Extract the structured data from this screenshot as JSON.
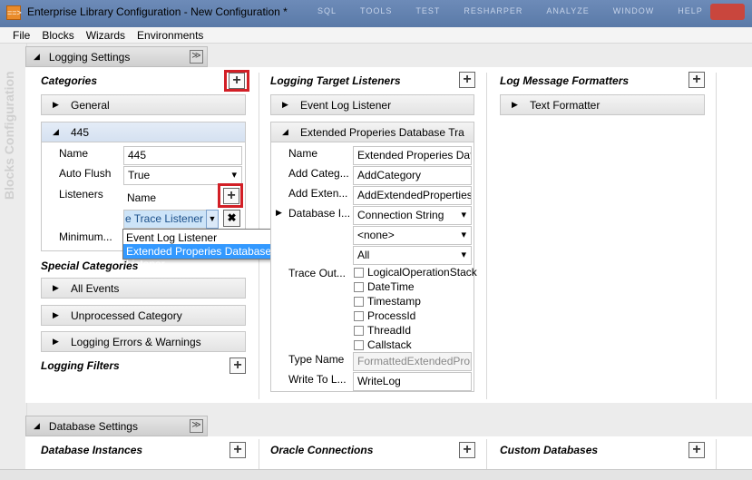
{
  "window": {
    "title": "Enterprise Library Configuration - New Configuration *",
    "icon_text": "==>",
    "vs_menu": [
      "SQL",
      "TOOLS",
      "TEST",
      "RESHARPER",
      "ANALYZE",
      "WINDOW",
      "HELP"
    ]
  },
  "menu": [
    "File",
    "Blocks",
    "Wizards",
    "Environments"
  ],
  "sidebar_label": "Blocks Configuration",
  "logging": {
    "header": "Logging Settings",
    "categories": {
      "title": "Categories",
      "general": "General",
      "expanded": {
        "title": "445",
        "name_label": "Name",
        "name_value": "445",
        "autoflush_label": "Auto Flush",
        "autoflush_value": "True",
        "listeners_label": "Listeners",
        "listeners_col": "Name",
        "listener_value": "e Trace Listener",
        "minimum_label": "Minimum...",
        "dropdown_options": [
          "Event Log Listener",
          "Extended Properies Database Trace Listener"
        ]
      }
    },
    "special": {
      "title": "Special Categories",
      "items": [
        "All Events",
        "Unprocessed Category",
        "Logging Errors & Warnings"
      ]
    },
    "filters": {
      "title": "Logging Filters"
    },
    "targets": {
      "title": "Logging Target Listeners",
      "event_log": "Event Log Listener",
      "expanded": {
        "title": "Extended Properies Database Tra",
        "name_label": "Name",
        "name_value": "Extended Properies Dat",
        "addcat_label": "Add Categ...",
        "addcat_value": "AddCategory",
        "addext_label": "Add Exten...",
        "addext_value": "AddExtendedProperties",
        "dbi_label": "Database I...",
        "dbi_value": "Connection String",
        "filter_value": "<none>",
        "sev_value": "All",
        "trace_label": "Trace Out...",
        "trace_options": [
          "LogicalOperationStack",
          "DateTime",
          "Timestamp",
          "ProcessId",
          "ThreadId",
          "Callstack"
        ],
        "type_label": "Type Name",
        "type_value": "FormattedExtendedProp",
        "write_label": "Write To L...",
        "write_value": "WriteLog"
      }
    },
    "formatters": {
      "title": "Log Message Formatters",
      "text": "Text Formatter"
    }
  },
  "database": {
    "header": "Database Settings",
    "instances": "Database Instances",
    "oracle": "Oracle Connections",
    "custom": "Custom Databases"
  }
}
